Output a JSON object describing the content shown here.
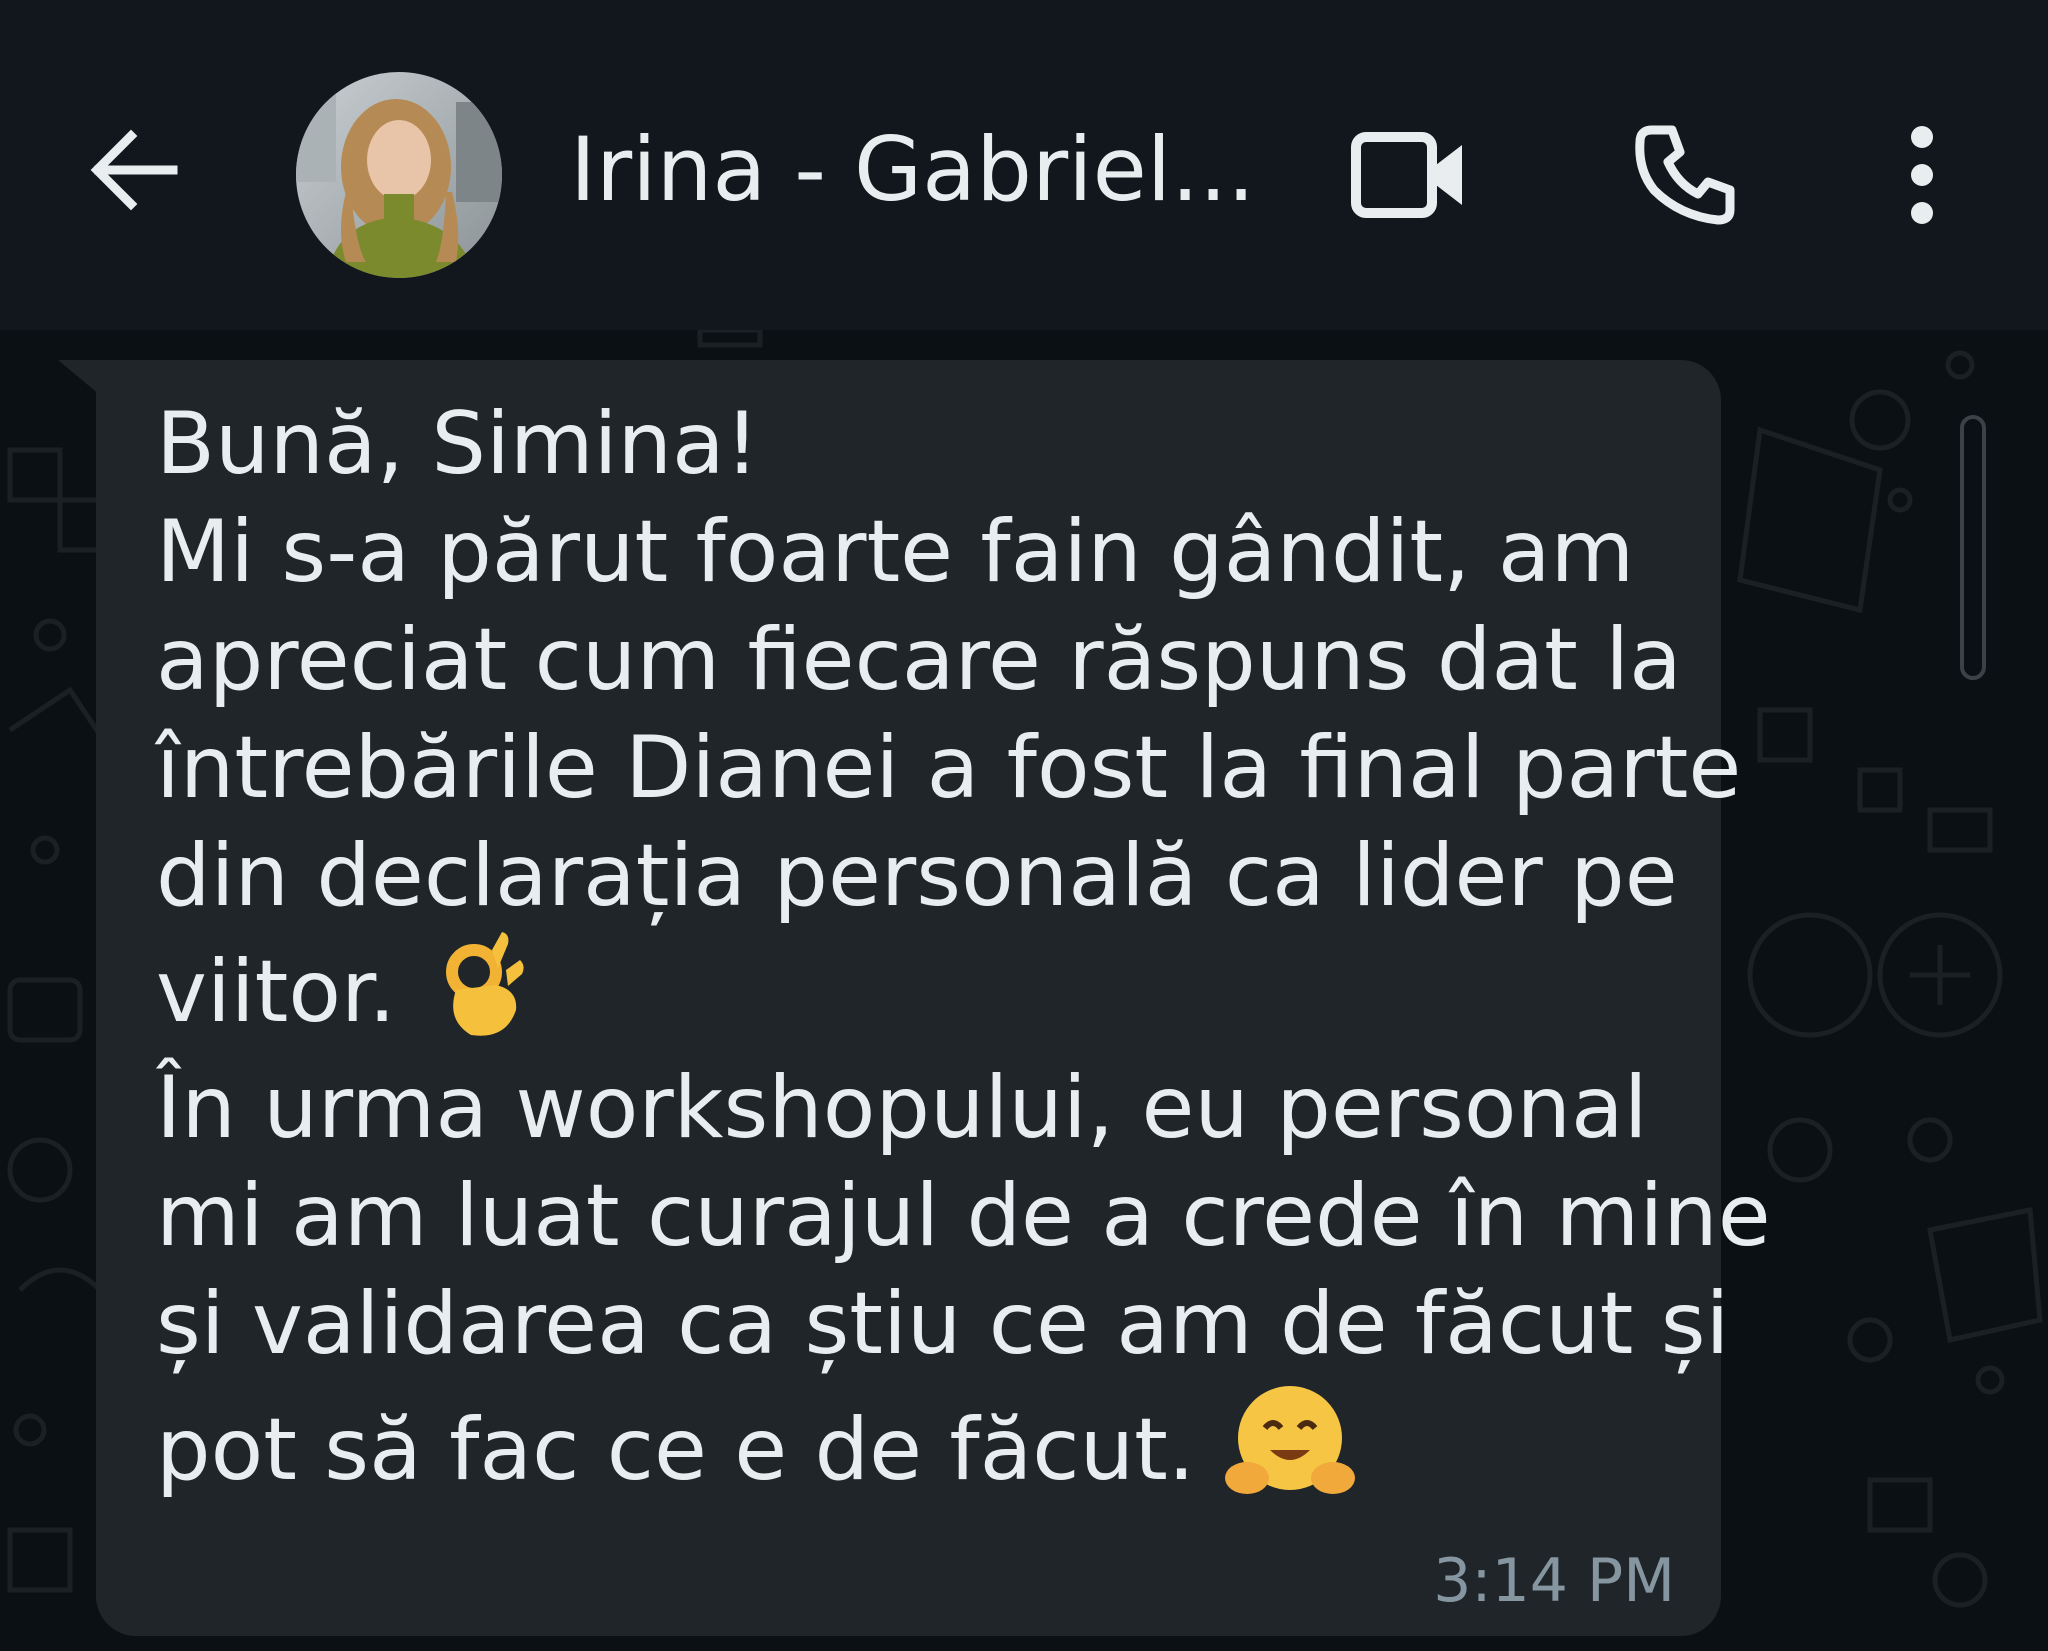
{
  "header": {
    "contact_name": "Irina - Gabriel...",
    "icons": {
      "back": "arrow-left-icon",
      "video": "video-camera-icon",
      "call": "phone-icon",
      "menu": "more-vertical-icon"
    }
  },
  "message": {
    "lines": [
      "Bună, Simina!",
      "Mi s-a părut foarte fain gândit, am",
      "apreciat cum fiecare răspuns dat la",
      "întrebările Dianei a fost la final parte",
      "din declarația personală ca lider pe",
      "viitor.",
      "În urma workshopului, eu personal",
      "mi am luat curajul de a crede în mine",
      "și validarea ca știu ce am de făcut și",
      "pot să fac ce e de făcut."
    ],
    "emojis": {
      "line_6": "ok-hand-emoji",
      "line_10": "hugging-face-emoji"
    },
    "timestamp": "3:14 PM"
  },
  "colors": {
    "header_bg": "#11171c",
    "chat_bg": "#0b1014",
    "bubble_bg": "#1f2529",
    "text": "#e9edef",
    "timestamp": "#8696a0"
  }
}
